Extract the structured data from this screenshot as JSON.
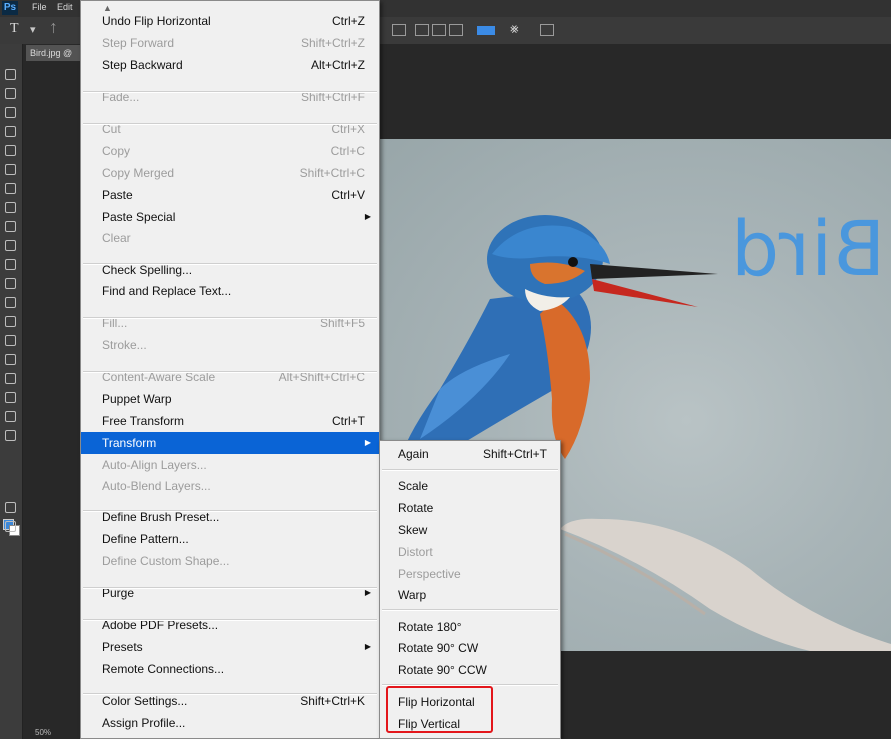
{
  "menubar": {
    "logo": "Ps",
    "items": [
      "File",
      "Edit"
    ]
  },
  "optionsbar": {
    "type_tool": "T",
    "type_tool_suffix": "▾",
    "orientation_icon": "ᛏ"
  },
  "document_tab": {
    "label": "Bird.jpg @"
  },
  "canvas": {
    "overlay_text": "Bird"
  },
  "status": {
    "zoom": "50%"
  },
  "edit_menu": {
    "scroll_arrow": "▲",
    "items": [
      {
        "label": "Undo Flip Horizontal",
        "shortcut": "Ctrl+Z",
        "state": "enabled"
      },
      {
        "label": "Step Forward",
        "shortcut": "Shift+Ctrl+Z",
        "state": "disabled"
      },
      {
        "label": "Step Backward",
        "shortcut": "Alt+Ctrl+Z",
        "state": "enabled"
      },
      {
        "label": "Fade...",
        "shortcut": "Shift+Ctrl+F",
        "state": "disabled"
      },
      {
        "label": "Cut",
        "shortcut": "Ctrl+X",
        "state": "disabled"
      },
      {
        "label": "Copy",
        "shortcut": "Ctrl+C",
        "state": "disabled"
      },
      {
        "label": "Copy Merged",
        "shortcut": "Shift+Ctrl+C",
        "state": "disabled"
      },
      {
        "label": "Paste",
        "shortcut": "Ctrl+V",
        "state": "enabled"
      },
      {
        "label": "Paste Special",
        "shortcut": "",
        "state": "enabled",
        "submenu": true
      },
      {
        "label": "Clear",
        "shortcut": "",
        "state": "disabled"
      },
      {
        "label": "Check Spelling...",
        "shortcut": "",
        "state": "enabled"
      },
      {
        "label": "Find and Replace Text...",
        "shortcut": "",
        "state": "enabled"
      },
      {
        "label": "Fill...",
        "shortcut": "Shift+F5",
        "state": "disabled"
      },
      {
        "label": "Stroke...",
        "shortcut": "",
        "state": "disabled"
      },
      {
        "label": "Content-Aware Scale",
        "shortcut": "Alt+Shift+Ctrl+C",
        "state": "disabled"
      },
      {
        "label": "Puppet Warp",
        "shortcut": "",
        "state": "enabled"
      },
      {
        "label": "Free Transform",
        "shortcut": "Ctrl+T",
        "state": "enabled"
      },
      {
        "label": "Transform",
        "shortcut": "",
        "state": "highlighted",
        "submenu": true
      },
      {
        "label": "Auto-Align Layers...",
        "shortcut": "",
        "state": "disabled"
      },
      {
        "label": "Auto-Blend Layers...",
        "shortcut": "",
        "state": "disabled"
      },
      {
        "label": "Define Brush Preset...",
        "shortcut": "",
        "state": "enabled"
      },
      {
        "label": "Define Pattern...",
        "shortcut": "",
        "state": "enabled"
      },
      {
        "label": "Define Custom Shape...",
        "shortcut": "",
        "state": "disabled"
      },
      {
        "label": "Purge",
        "shortcut": "",
        "state": "enabled",
        "submenu": true
      },
      {
        "label": "Adobe PDF Presets...",
        "shortcut": "",
        "state": "enabled"
      },
      {
        "label": "Presets",
        "shortcut": "",
        "state": "enabled",
        "submenu": true
      },
      {
        "label": "Remote Connections...",
        "shortcut": "",
        "state": "enabled"
      },
      {
        "label": "Color Settings...",
        "shortcut": "Shift+Ctrl+K",
        "state": "enabled"
      },
      {
        "label": "Assign Profile...",
        "shortcut": "",
        "state": "enabled"
      }
    ]
  },
  "transform_submenu": {
    "items": [
      {
        "label": "Again",
        "shortcut": "Shift+Ctrl+T",
        "state": "enabled"
      },
      {
        "label": "Scale",
        "shortcut": "",
        "state": "enabled"
      },
      {
        "label": "Rotate",
        "shortcut": "",
        "state": "enabled"
      },
      {
        "label": "Skew",
        "shortcut": "",
        "state": "enabled"
      },
      {
        "label": "Distort",
        "shortcut": "",
        "state": "disabled"
      },
      {
        "label": "Perspective",
        "shortcut": "",
        "state": "disabled"
      },
      {
        "label": "Warp",
        "shortcut": "",
        "state": "enabled"
      },
      {
        "label": "Rotate 180°",
        "shortcut": "",
        "state": "enabled"
      },
      {
        "label": "Rotate 90° CW",
        "shortcut": "",
        "state": "enabled"
      },
      {
        "label": "Rotate 90° CCW",
        "shortcut": "",
        "state": "enabled"
      },
      {
        "label": "Flip Horizontal",
        "shortcut": "",
        "state": "enabled"
      },
      {
        "label": "Flip Vertical",
        "shortcut": "",
        "state": "enabled"
      }
    ]
  },
  "colors": {
    "highlight": "#0a64d6",
    "callout": "#e3161b",
    "foreground": "#3b87d8",
    "background": "#ffffff"
  }
}
